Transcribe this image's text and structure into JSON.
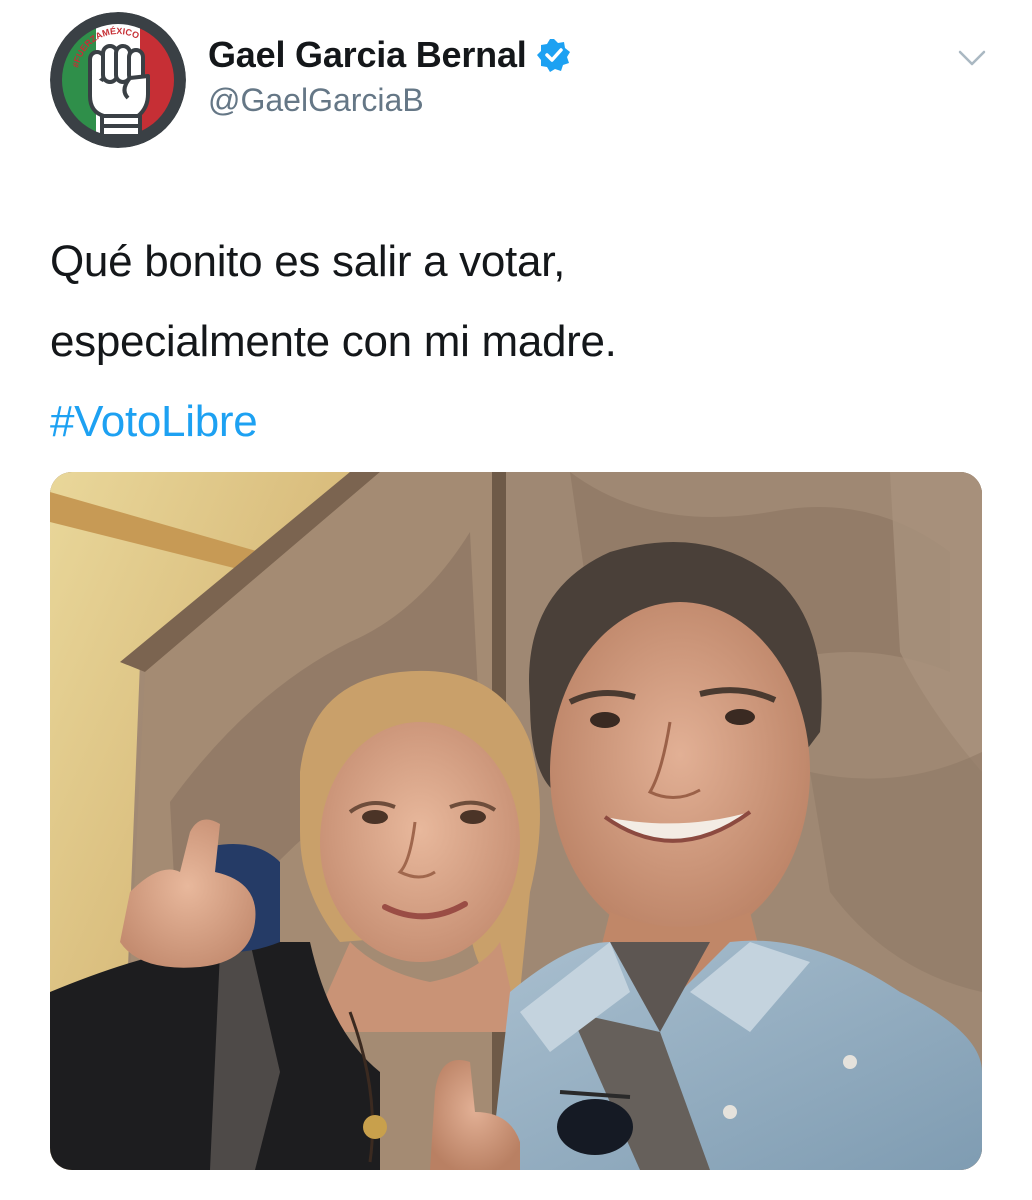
{
  "tweet": {
    "author": {
      "display_name": "Gael Garcia Bernal",
      "handle": "@GaelGarciaB",
      "verified": true,
      "avatar": {
        "badge_text": "#FUERZAMÉXICO",
        "icon": "raised-fist-icon",
        "colors": {
          "green": "#2f8f4a",
          "red": "#c62f35",
          "ring": "#3a4045"
        }
      }
    },
    "menu_icon": "chevron-down-icon",
    "text": {
      "line1": "Qué bonito es salir a votar,",
      "line2": "especialmente con mi madre.",
      "hashtag": "#VotoLibre"
    },
    "media": {
      "type": "photo"
    }
  },
  "colors": {
    "text": "#14171a",
    "secondary": "#657786",
    "link": "#1da1f2"
  }
}
